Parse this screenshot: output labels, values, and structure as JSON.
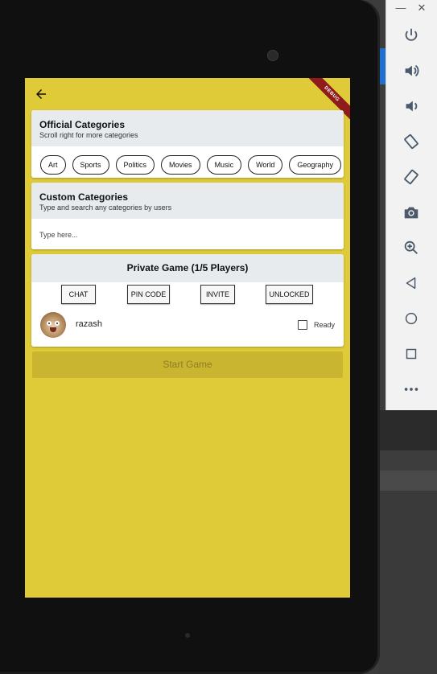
{
  "app": {
    "debug_banner": "DEBUG"
  },
  "official": {
    "title": "Official Categories",
    "subtitle": "Scroll right for more categories",
    "chips": [
      "Art",
      "Sports",
      "Politics",
      "Movies",
      "Music",
      "World",
      "Geography",
      ""
    ]
  },
  "custom": {
    "title": "Custom Categories",
    "subtitle": "Type and search any categories by users",
    "placeholder": "Type here..."
  },
  "private_game": {
    "title": "Private Game (1/5 Players)",
    "actions": {
      "chat": "CHAT",
      "pin_code": "PIN CODE",
      "invite": "INVITE",
      "unlocked": "UNLOCKED"
    },
    "player": {
      "name": "razash",
      "ready_label": "Ready",
      "ready_checked": false
    }
  },
  "start_button": "Start Game",
  "colors": {
    "background": "#dfca38",
    "card_header": "#e8ebee",
    "start_button": "#c9b530",
    "debug_ribbon": "#8f1b1b"
  },
  "emulator": {
    "window_controls": [
      "minimize-icon",
      "close-icon"
    ],
    "buttons": [
      "power-icon",
      "volume-up-icon",
      "volume-down-icon",
      "rotate-left-icon",
      "rotate-right-icon",
      "camera-icon",
      "zoom-icon",
      "back-icon",
      "home-icon",
      "overview-icon",
      "more-icon"
    ]
  }
}
